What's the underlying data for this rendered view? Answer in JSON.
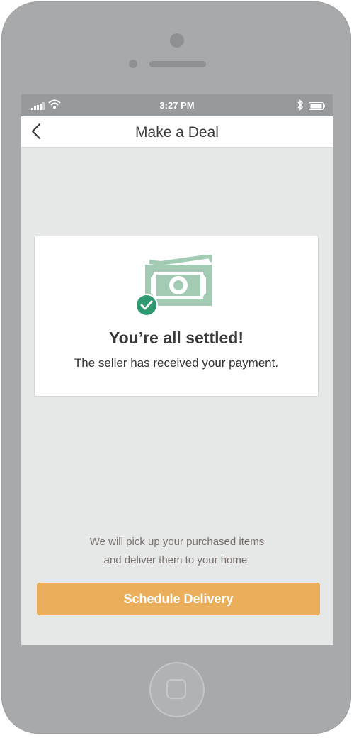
{
  "status_bar": {
    "time": "3:27 PM",
    "icons": [
      "signal-icon",
      "wifi-icon",
      "bluetooth-icon",
      "battery-icon"
    ]
  },
  "nav": {
    "back_icon": "chevron-left-icon",
    "title": "Make a Deal"
  },
  "confirmation": {
    "icon": "money-check-icon",
    "title": "You’re all settled!",
    "subtitle": "The seller has received your payment."
  },
  "delivery_info": {
    "line1": "We will pick up your purchased items",
    "line2": "and deliver them to your home."
  },
  "cta": {
    "label": "Schedule Delivery"
  },
  "colors": {
    "accent_orange": "#ebaf5c",
    "money_green": "#a3cbb4",
    "check_green": "#2f9a70",
    "screen_bg": "#e5e8e7"
  }
}
